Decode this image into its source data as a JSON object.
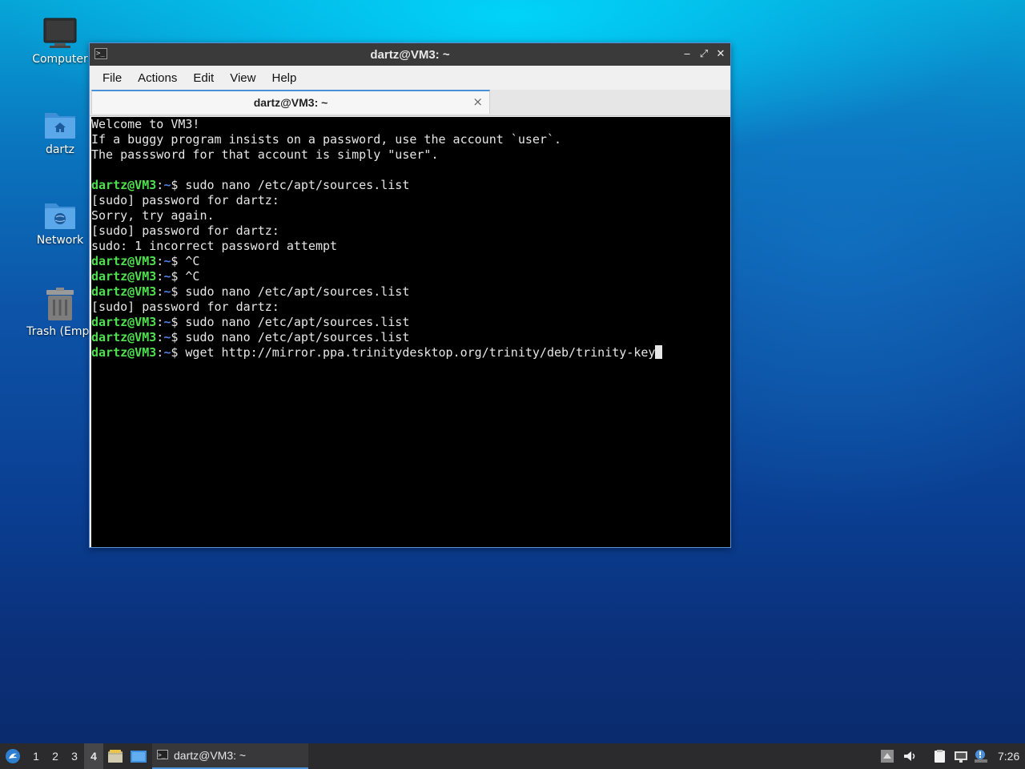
{
  "desktop": {
    "icons": [
      {
        "label": "Computer"
      },
      {
        "label": "dartz"
      },
      {
        "label": "Network"
      },
      {
        "label": "Trash (Empt"
      }
    ]
  },
  "window": {
    "title": "dartz@VM3: ~",
    "menu": [
      "File",
      "Actions",
      "Edit",
      "View",
      "Help"
    ],
    "tab_label": "dartz@VM3: ~",
    "tab_close": "×",
    "buttons": {
      "minimize": "‒",
      "maximize": "⤢",
      "close": "✕"
    }
  },
  "terminal": {
    "prompt_user": "dartz@VM3",
    "prompt_sep": ":",
    "prompt_path": "~",
    "prompt_end": "$ ",
    "lines": [
      {
        "text": "Welcome to VM3!"
      },
      {
        "text": "If a buggy program insists on a password, use the account `user`."
      },
      {
        "text": "The passsword for that account is simply \"user\"."
      },
      {
        "text": ""
      },
      {
        "cmd": "sudo nano /etc/apt/sources.list"
      },
      {
        "text": "[sudo] password for dartz:"
      },
      {
        "text": "Sorry, try again."
      },
      {
        "text": "[sudo] password for dartz:"
      },
      {
        "text": "sudo: 1 incorrect password attempt"
      },
      {
        "cmd": "^C"
      },
      {
        "cmd": "^C"
      },
      {
        "cmd": "sudo nano /etc/apt/sources.list"
      },
      {
        "text": "[sudo] password for dartz:"
      },
      {
        "cmd": "sudo nano /etc/apt/sources.list"
      },
      {
        "cmd": "sudo nano /etc/apt/sources.list"
      },
      {
        "cmd": "wget http://mirror.ppa.trinitydesktop.org/trinity/deb/trinity-key",
        "cursor": true
      }
    ]
  },
  "taskbar": {
    "workspaces": [
      "1",
      "2",
      "3",
      "4"
    ],
    "active_workspace": "4",
    "task_label": "dartz@VM3: ~",
    "clock": "7:26"
  },
  "colors": {
    "prompt_green": "#4ee04e",
    "prompt_blue": "#4e7fe0",
    "accent": "#4a90d9"
  }
}
